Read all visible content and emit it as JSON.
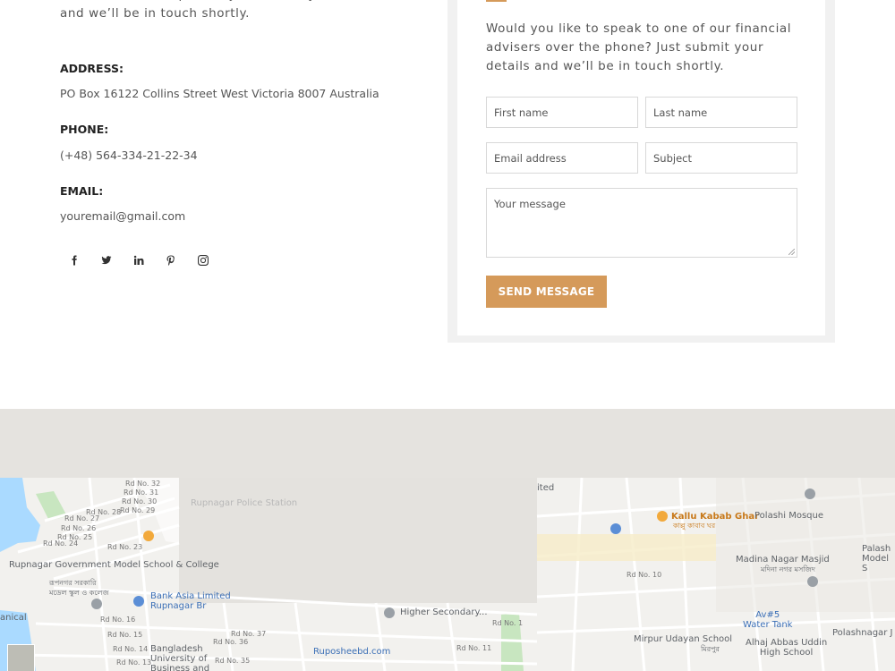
{
  "contact": {
    "intro": "advisers over the phone? Just submit your details and we’ll be in touch shortly.",
    "address_label": "ADDRESS:",
    "address_value": "PO Box 16122 Collins Street West Victoria 8007 Australia",
    "phone_label": "PHONE:",
    "phone_value": "(+48) 564-334-21-22-34",
    "email_label": "EMAIL:",
    "email_value": "youremail@gmail.com",
    "social_icons": [
      "facebook-icon",
      "twitter-icon",
      "linkedin-icon",
      "pinterest-icon",
      "instagram-icon"
    ]
  },
  "form": {
    "description": "Would you like to speak to one of our financial advisers over the phone? Just submit your details and we’ll be in touch shortly.",
    "first_name_placeholder": "First name",
    "last_name_placeholder": "Last name",
    "email_placeholder": "Email address",
    "subject_placeholder": "Subject",
    "message_placeholder": "Your message",
    "submit_label": "SEND MESSAGE",
    "accent_color": "#d59a5a"
  },
  "map": {
    "labels": {
      "rupnagar_school": "Rupnagar Government\nModel School & College",
      "rupnagar_school_bn": "রূপনগর সরকারি\nমডেল স্কুল ও কলেজ",
      "bank_asia": "Bank Asia Limited",
      "rupnagar_branch": "Rupnagar Br",
      "rupnagar_police": "Rupnagar Police Station",
      "higher_secondary": "Higher Secondary...",
      "bangladesh_univ": "Bangladesh\nUniversity of\nBusiness and",
      "ruposheebd": "Ruposheebd.com",
      "kallu_kabab": "Kallu Kabab Ghar",
      "kallu_kabab_bn": "কাল্লু কাবাব ঘর",
      "polashi_mosque": "Polashi Mosque",
      "madina_masjid": "Madina Nagar Masjid",
      "madina_masjid_bn": "মদিনা নগর মসজিদ",
      "palashnagar_model": "Palash\nModel S",
      "av5_water": "Av#5\nWater Tank",
      "mirpur_udayan": "Mirpur Udayan School",
      "mirpur_udayan_bn": "মিরপুর",
      "alhaj_abbas": "Alhaj Abbas Uddin\nHigh School",
      "polashnagar": "Polashnagar J",
      "united": "ited",
      "anical": "anical"
    },
    "roads": [
      "Rd No. 32",
      "Rd No. 31",
      "Rd No. 30",
      "Rd No. 29",
      "Rd No. 28",
      "Rd No. 27",
      "Rd No. 26",
      "Rd No. 25",
      "Rd No. 24",
      "Rd No. 23",
      "Rd No. 16",
      "Rd No. 15",
      "Rd No. 14",
      "Rd No. 13",
      "Rd No. 37",
      "Rd No. 36",
      "Rd No. 35",
      "Rd No. 10",
      "Rd No. 1",
      "Rd No. 11"
    ]
  }
}
